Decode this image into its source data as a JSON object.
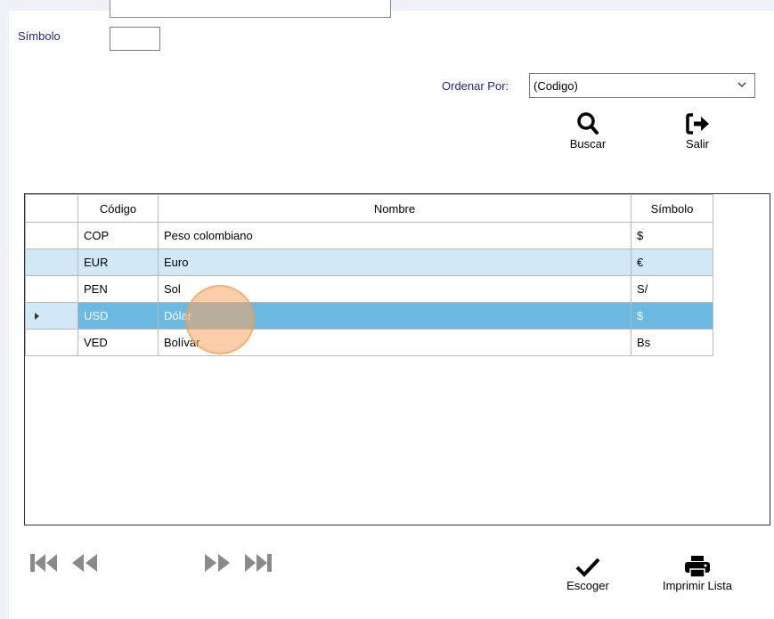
{
  "form": {
    "simbolo_label": "Símbolo",
    "simbolo_value": "",
    "ordenar_label": "Ordenar Por:",
    "ordenar_value": "(Codigo)"
  },
  "toolbar": {
    "buscar_label": "Buscar",
    "salir_label": "Salir",
    "escoger_label": "Escoger",
    "imprimir_label": "Imprimir Lista"
  },
  "table": {
    "columns": [
      "Código",
      "Nombre",
      "Símbolo"
    ],
    "rows": [
      {
        "codigo": "COP",
        "nombre": "Peso colombiano",
        "simbolo": "$"
      },
      {
        "codigo": "EUR",
        "nombre": "Euro",
        "simbolo": "€"
      },
      {
        "codigo": "PEN",
        "nombre": "Sol",
        "simbolo": "S/"
      },
      {
        "codigo": "USD",
        "nombre": "Dólar",
        "simbolo": "$"
      },
      {
        "codigo": "VED",
        "nombre": "Bolívar",
        "simbolo": "Bs"
      }
    ],
    "selected_row": 3
  },
  "icons": {
    "buscar": "search-icon",
    "salir": "exit-icon",
    "escoger": "checkmark-icon",
    "imprimir": "printer-icon",
    "first": "first-record-icon",
    "prev": "previous-record-icon",
    "next": "next-record-icon",
    "last": "last-record-icon"
  },
  "colors": {
    "label_blue": "#1b2a8a",
    "alt_row": "#d1e8f6",
    "selected_row": "#6cb9e3",
    "nav_icon": "#8a8a8a"
  }
}
